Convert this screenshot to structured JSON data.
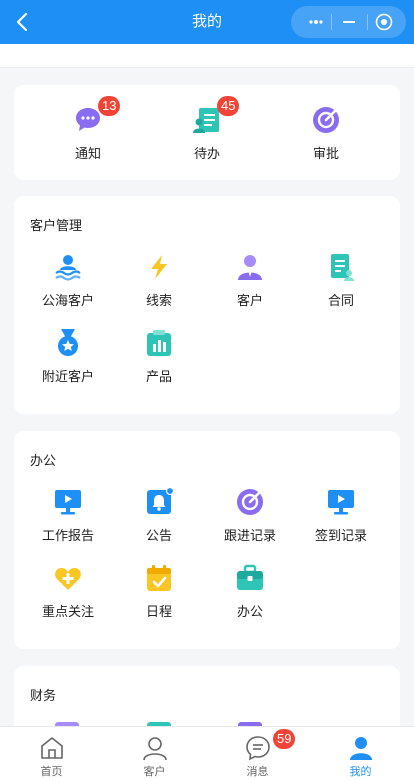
{
  "header": {
    "title": "我的"
  },
  "quick": [
    {
      "label": "通知",
      "badge": "13",
      "icon": "chat-bubble-icon"
    },
    {
      "label": "待办",
      "badge": "45",
      "icon": "todo-list-icon"
    },
    {
      "label": "审批",
      "badge": "",
      "icon": "approval-icon"
    }
  ],
  "crm": {
    "title": "客户管理",
    "items": [
      {
        "label": "公海客户",
        "icon": "sea-customers-icon"
      },
      {
        "label": "线索",
        "icon": "lightning-icon"
      },
      {
        "label": "客户",
        "icon": "customer-icon"
      },
      {
        "label": "合同",
        "icon": "contract-icon"
      },
      {
        "label": "附近客户",
        "icon": "nearby-medal-icon"
      },
      {
        "label": "产品",
        "icon": "product-icon"
      }
    ]
  },
  "office": {
    "title": "办公",
    "items": [
      {
        "label": "工作报告",
        "icon": "work-report-icon"
      },
      {
        "label": "公告",
        "icon": "announcement-icon"
      },
      {
        "label": "跟进记录",
        "icon": "follow-up-icon"
      },
      {
        "label": "签到记录",
        "icon": "check-in-icon"
      },
      {
        "label": "重点关注",
        "icon": "heart-plus-icon"
      },
      {
        "label": "日程",
        "icon": "calendar-icon"
      },
      {
        "label": "办公",
        "icon": "briefcase-icon"
      }
    ]
  },
  "finance": {
    "title": "财务"
  },
  "tabbar": {
    "tabs": [
      {
        "label": "首页",
        "icon": "home-icon",
        "badge": ""
      },
      {
        "label": "客户",
        "icon": "person-outline-icon",
        "badge": ""
      },
      {
        "label": "消息",
        "icon": "message-icon",
        "badge": "59"
      },
      {
        "label": "我的",
        "icon": "person-filled-icon",
        "badge": ""
      }
    ],
    "active_tab": "我的"
  },
  "colors": {
    "primary": "#1e8ff5",
    "badge": "#f04437",
    "purple": "#8a6cf0",
    "teal": "#2ec4b6",
    "yellow": "#f9c623"
  }
}
